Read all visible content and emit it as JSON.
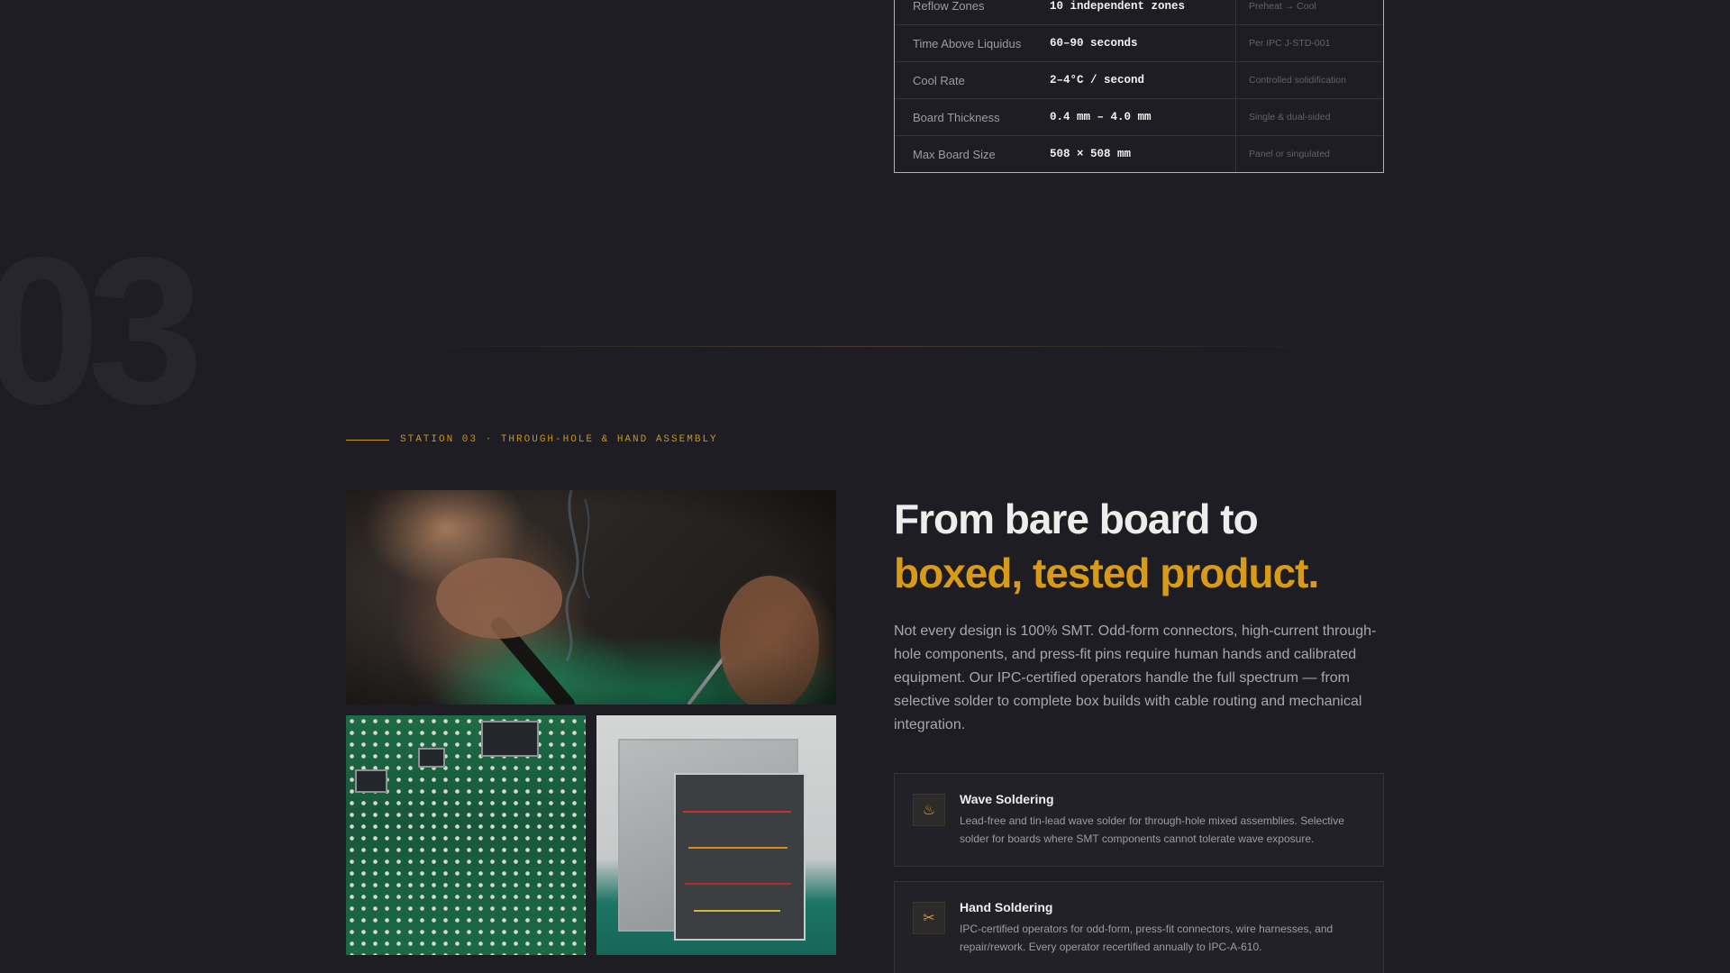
{
  "specs": {
    "rows": [
      {
        "label": "Reflow Zones",
        "value": "10 independent zones",
        "note": "Preheat → Cool"
      },
      {
        "label": "Time Above Liquidus",
        "value": "60–90 seconds",
        "note": "Per IPC J-STD-001"
      },
      {
        "label": "Cool Rate",
        "value": "2–4°C / second",
        "note": "Controlled solidification"
      },
      {
        "label": "Board Thickness",
        "value": "0.4 mm – 4.0 mm",
        "note": "Single & dual-sided"
      },
      {
        "label": "Max Board Size",
        "value": "508 × 508 mm",
        "note": "Panel or singulated"
      }
    ]
  },
  "station": {
    "number": "03",
    "eyebrow": "STATION 03 · THROUGH-HOLE & HAND ASSEMBLY",
    "headline_line1": "From bare board to",
    "headline_line2": "boxed, tested product.",
    "body": "Not every design is 100% SMT. Odd-form connectors, high-current through-hole components, and press-fit pins require human hands and calibrated equipment. Our IPC-certified operators handle the full spectrum — from selective solder to complete box builds with cable routing and mechanical integration."
  },
  "cards": [
    {
      "icon": "flame-icon",
      "glyph": "♨",
      "title": "Wave Soldering",
      "desc": "Lead-free and tin-lead wave solder for through-hole mixed assemblies. Selective solder for boards where SMT components cannot tolerate wave exposure."
    },
    {
      "icon": "tools-icon",
      "glyph": "✂",
      "title": "Hand Soldering",
      "desc": "IPC-certified operators for odd-form, press-fit connectors, wire harnesses, and repair/rework. Every operator recertified annually to IPC-A-610."
    }
  ],
  "colors": {
    "accent": "#d99a16",
    "background": "#1e1d23"
  }
}
